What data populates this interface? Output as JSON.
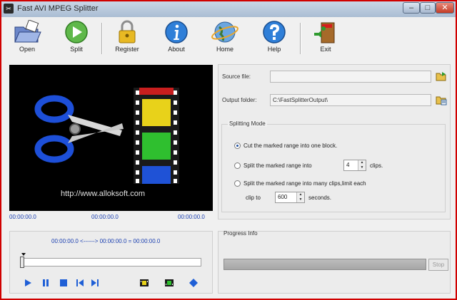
{
  "window": {
    "title": "Fast AVI MPEG Splitter",
    "app_icon": "scissors-app-icon"
  },
  "titlebar_buttons": {
    "minimize": "–",
    "maximize": "□",
    "close": "✕"
  },
  "toolbar": {
    "open_label": "Open",
    "split_label": "Split",
    "register_label": "Register",
    "about_label": "About",
    "home_label": "Home",
    "help_label": "Help",
    "exit_label": "Exit"
  },
  "preview": {
    "url": "http://www.alloksoft.com"
  },
  "timecodes": {
    "start": "00:00:00.0",
    "current": "00:00:00.0",
    "end": "00:00:00.0"
  },
  "files": {
    "source_label": "Source file:",
    "source_value": "",
    "output_label": "Output folder:",
    "output_value": "C:\\FastSplitterOutput\\"
  },
  "splitting": {
    "title": "Splitting Mode",
    "option1": "Cut the marked range into one block.",
    "option2": "Split the marked range into",
    "clips_count": "4",
    "clips_label": "clips.",
    "option3": "Split the marked range into many clips,limit each",
    "clip_to_label": "clip to",
    "seconds_value": "600",
    "seconds_label": "seconds.",
    "selected": 1
  },
  "range": {
    "text": "00:00:00.0 <------> 00:00:00.0 =  00:00:00.0"
  },
  "progress": {
    "title": "Progress Info",
    "stop_label": "Stop",
    "value": 0
  },
  "colors": {
    "accent_blue": "#1a3fb0",
    "window_border": "#d00000"
  }
}
